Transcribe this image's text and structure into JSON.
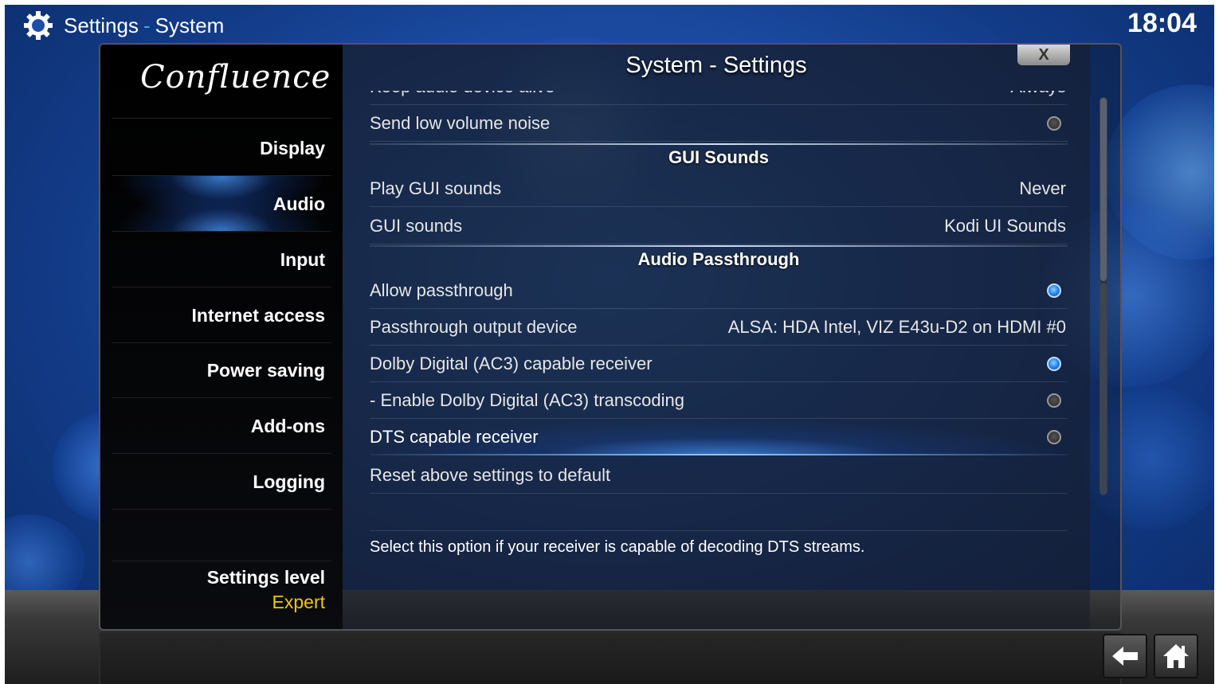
{
  "topbar": {
    "section": "Settings",
    "separator": "-",
    "subsection": "System",
    "clock": "18:04"
  },
  "sidebar": {
    "logo": "Confluence",
    "items": [
      {
        "label": "Display"
      },
      {
        "label": "Audio"
      },
      {
        "label": "Input"
      },
      {
        "label": "Internet access"
      },
      {
        "label": "Power saving"
      },
      {
        "label": "Add-ons"
      },
      {
        "label": "Logging"
      }
    ],
    "selected": "Audio",
    "settings_level_label": "Settings level",
    "settings_level_value": "Expert"
  },
  "content": {
    "title": "System - Settings",
    "close_label": "X",
    "rows": [
      {
        "label": "Keep audio device alive",
        "value": "Always"
      },
      {
        "label": "Send low volume noise",
        "toggle": false
      },
      {
        "header": "GUI Sounds"
      },
      {
        "label": "Play GUI sounds",
        "value": "Never"
      },
      {
        "label": "GUI sounds",
        "value": "Kodi UI Sounds"
      },
      {
        "header": "Audio Passthrough"
      },
      {
        "label": "Allow passthrough",
        "toggle": true
      },
      {
        "label": "Passthrough output device",
        "value": "ALSA: HDA Intel, VIZ E43u-D2 on HDMI #0"
      },
      {
        "label": "Dolby Digital (AC3) capable receiver",
        "toggle": true
      },
      {
        "label": "- Enable Dolby Digital (AC3) transcoding",
        "toggle": false
      },
      {
        "label": "DTS capable receiver",
        "toggle": false,
        "focused": true
      },
      {
        "label": "Reset above settings to default"
      }
    ],
    "description": "Select this option if your receiver is capable of decoding DTS streams."
  },
  "bottom": {
    "back_icon": "back-arrow-icon",
    "home_icon": "home-icon"
  },
  "colors": {
    "accent": "#3fa0ff",
    "settings_level_value": "#f0c800",
    "toggle_on": "#1e7ef0"
  }
}
